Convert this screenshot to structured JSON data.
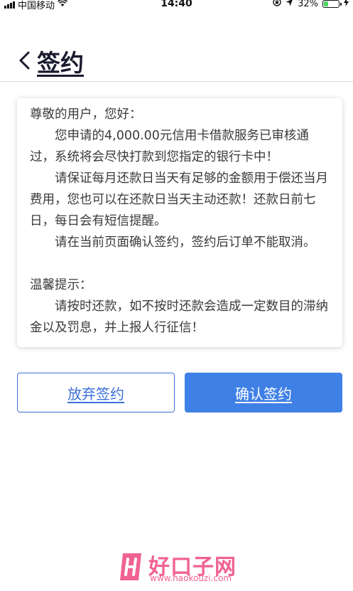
{
  "status_bar": {
    "carrier": "中国移动",
    "time": "14:40",
    "battery": "32%",
    "battery_level": 0.32
  },
  "header": {
    "title": "签约"
  },
  "card": {
    "greeting": "尊敬的用户，您好：",
    "para1": "您申请的4,000.00元信用卡借款服务已审核通过，系统将会尽快打款到您指定的银行卡中！",
    "para2": "请保证每月还款日当天有足够的金额用于偿还当月费用，您也可以在还款日当天主动还款！还款日前七日，每日会有短信提醒。",
    "para3": "请在当前页面确认签约，签约后订单不能取消。",
    "tip_title": "温馨提示：",
    "tip_text": "请按时还款，如不按时还款会造成一定数目的滞纳金以及罚息，并上报人行征信！"
  },
  "buttons": {
    "reject": "放弃签约",
    "confirm": "确认签约"
  },
  "watermark": {
    "name": "好口子网",
    "url": "www.haokouzi.com"
  },
  "colors": {
    "accent": "#3f80e6",
    "watermark": "#f06292",
    "battery_fill": "#4cd964"
  }
}
